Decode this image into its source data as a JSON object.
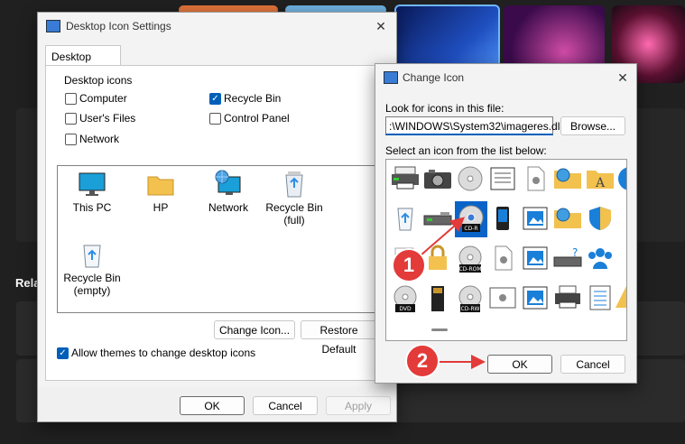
{
  "desktop_icon_settings": {
    "title": "Desktop Icon Settings",
    "tab": "Desktop Icons",
    "group_label": "Desktop icons",
    "checkboxes": [
      {
        "label": "Computer",
        "checked": false
      },
      {
        "label": "Recycle Bin",
        "checked": true
      },
      {
        "label": "User's Files",
        "checked": false
      },
      {
        "label": "Control Panel",
        "checked": false
      },
      {
        "label": "Network",
        "checked": false
      }
    ],
    "icons": [
      {
        "label": "This PC",
        "icon": "monitor-icon"
      },
      {
        "label": "HP",
        "icon": "folder-icon"
      },
      {
        "label": "Network",
        "icon": "network-icon"
      },
      {
        "label": "Recycle Bin (full)",
        "line1": "Recycle Bin",
        "line2": "(full)",
        "icon": "recycle-bin-full-icon"
      },
      {
        "label": "Recycle Bin (empty)",
        "line1": "Recycle Bin",
        "line2": "(empty)",
        "icon": "recycle-bin-empty-icon"
      }
    ],
    "change_icon_button": "Change Icon...",
    "restore_default_button": "Restore Default",
    "allow_themes_label": "Allow themes to change desktop icons",
    "allow_themes_checked": true,
    "ok": "OK",
    "cancel": "Cancel",
    "apply": "Apply"
  },
  "change_icon": {
    "title": "Change Icon",
    "look_for_label": "Look for icons in this file:",
    "file_path": ":\\WINDOWS\\System32\\imageres.dll",
    "browse_button": "Browse...",
    "select_label": "Select an icon from the list below:",
    "selected_icon": "CD-R",
    "grid_labels": {
      "cdr": "CD-R",
      "cdrom": "CD-ROM",
      "dvd": "DVD",
      "cdrw": "CD-RW"
    },
    "ok": "OK",
    "cancel": "Cancel"
  },
  "callouts": [
    "1",
    "2"
  ],
  "background": {
    "partial_text": "Rela"
  },
  "colors": {
    "accent": "#005fb8",
    "callout": "#e33a3a",
    "selection": "#0a64c8"
  }
}
